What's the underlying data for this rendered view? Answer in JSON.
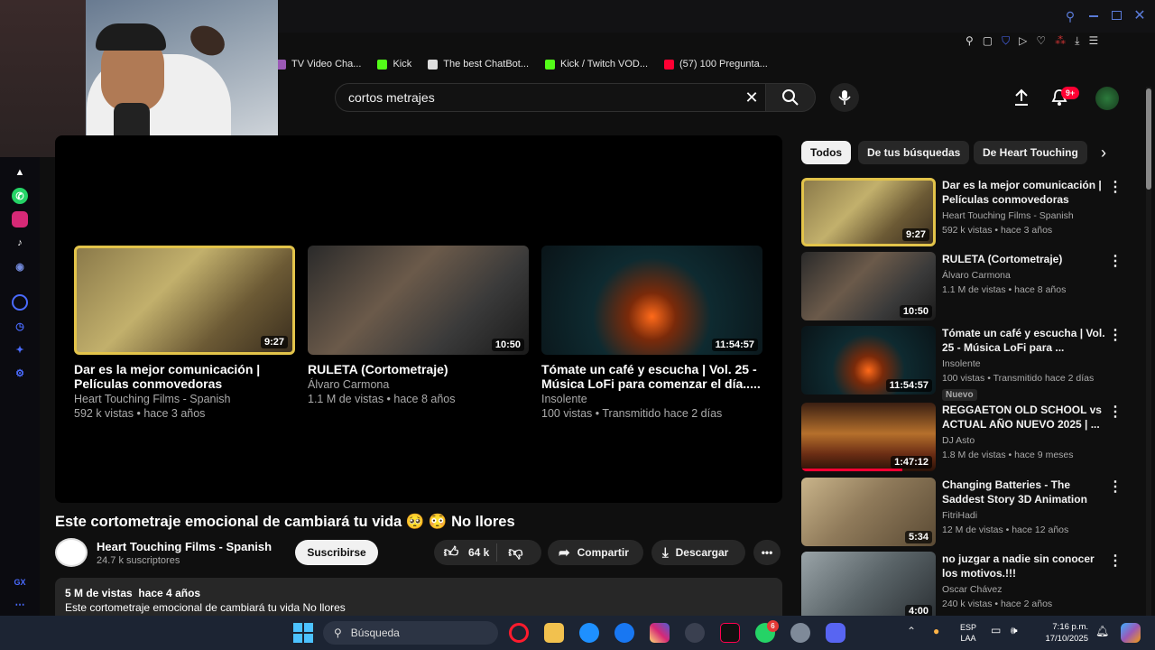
{
  "bookmarks": [
    {
      "label": "TV Video Cha...",
      "color": "#9b59b6"
    },
    {
      "label": "Kick",
      "color": "#53fc18"
    },
    {
      "label": "The best ChatBot...",
      "color": "#dddddd"
    },
    {
      "label": "Kick / Twitch VOD...",
      "color": "#53fc18"
    },
    {
      "label": "(57) 100 Pregunta...",
      "color": "#ff0033"
    }
  ],
  "search": {
    "query": "cortos metrajes"
  },
  "header": {
    "notif_badge": "9+"
  },
  "chips": [
    "Todos",
    "De tus búsquedas",
    "De Heart Touching"
  ],
  "endscreen": [
    {
      "title": "Dar es la mejor comunicación | Películas conmovedoras",
      "channel": "Heart Touching Films - Spanish",
      "meta": "592 k vistas • hace 3 años",
      "duration": "9:27"
    },
    {
      "title": "RULETA (Cortometraje)",
      "channel": "Álvaro Carmona",
      "meta": "1.1 M de vistas • hace 8 años",
      "duration": "10:50"
    },
    {
      "title": "Tómate un café y escucha | Vol. 25 - Música LoFi para comenzar el día.....",
      "channel": "Insolente",
      "meta": "100 vistas • Transmitido hace 2 días",
      "duration": "11:54:57"
    }
  ],
  "video": {
    "title": "Este cortometraje emocional de cambiará tu vida 🥺 😳  No llores",
    "channel": "Heart Touching Films - Spanish",
    "subs": "24.7 k suscriptores",
    "subscribe": "Suscribirse",
    "likes": "64 k",
    "share": "Compartir",
    "download": "Descargar",
    "desc_meta": "5 M de vistas  hace 4 años",
    "desc_text": "Este cortometraje emocional de cambiará tu vida No llores"
  },
  "related": [
    {
      "title": "Dar es la mejor comunicación | Películas conmovedoras",
      "channel": "Heart Touching Films - Spanish",
      "meta": "592 k vistas • hace 3 años",
      "duration": "9:27",
      "badge": ""
    },
    {
      "title": "RULETA (Cortometraje)",
      "channel": "Álvaro Carmona",
      "meta": "1.1 M de vistas • hace 8 años",
      "duration": "10:50",
      "badge": ""
    },
    {
      "title": "Tómate un café y escucha | Vol. 25  -  Música LoFi para ...",
      "channel": "Insolente",
      "meta": "100 vistas • Transmitido hace 2 días",
      "duration": "11:54:57",
      "badge": "Nuevo"
    },
    {
      "title": "REGGAETON OLD SCHOOL vs ACTUAL AÑO NUEVO 2025 | ...",
      "channel": "DJ Asto",
      "meta": "1.8 M de vistas • hace 9 meses",
      "duration": "1:47:12",
      "badge": ""
    },
    {
      "title": "Changing Batteries - The Saddest Story 3D Animation",
      "channel": "FitriHadi",
      "meta": "12 M de vistas • hace 12 años",
      "duration": "5:34",
      "badge": ""
    },
    {
      "title": "no juzgar a nadie sin conocer los motivos.!!!",
      "channel": "Oscar Chávez",
      "meta": "240 k vistas • hace 2 años",
      "duration": "4:00",
      "badge": ""
    }
  ],
  "taskbar": {
    "search": "Búsqueda",
    "lang1": "ESP",
    "lang2": "LAA",
    "time": "7:16 p.m.",
    "date": "17/10/2025",
    "badge_a": "6"
  },
  "colors": {
    "accent": "#ff0033",
    "chip_active": "#f1f1f1",
    "gold": "#e3c44a"
  }
}
